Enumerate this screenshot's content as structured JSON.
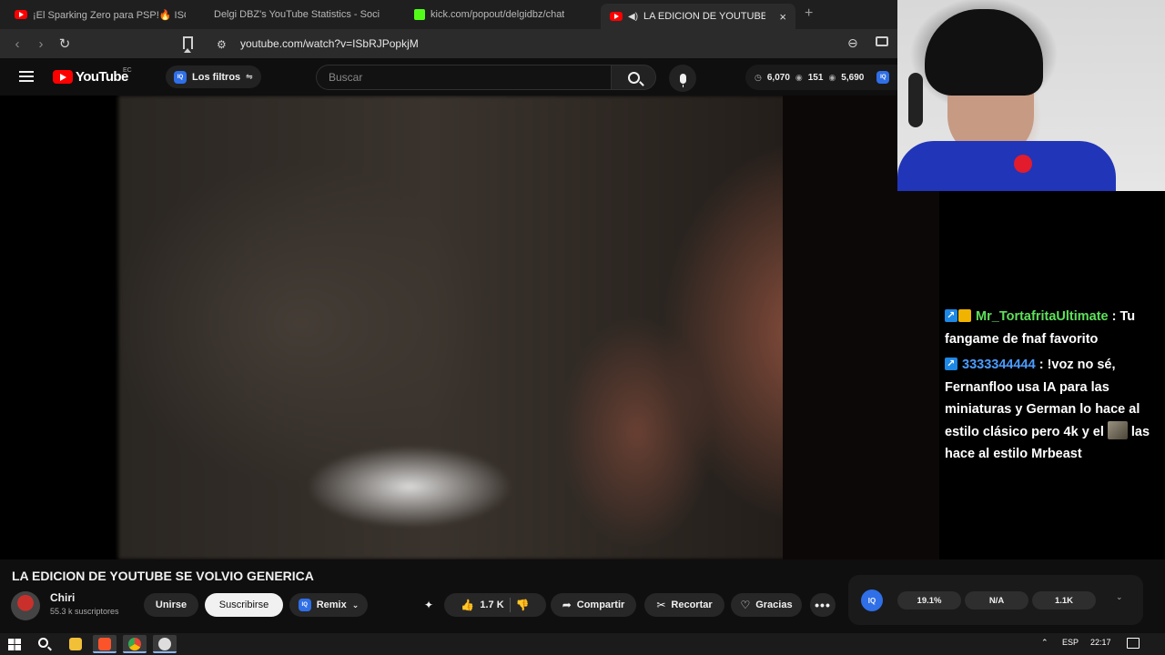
{
  "browser": {
    "tabs": [
      {
        "title": "¡El Sparking Zero para PSP!🔥 ISO en",
        "favicon": "youtube-icon",
        "active": false
      },
      {
        "title": "Delgi DBZ's YouTube Statistics - Soci",
        "favicon": "stats-icon",
        "active": false
      },
      {
        "title": "kick.com/popout/delgidbz/chat",
        "favicon": "kick-icon",
        "active": false
      },
      {
        "title": "LA EDICION DE YOUTUBE SE",
        "favicon": "youtube-icon",
        "active": true
      }
    ],
    "new_tab": "+",
    "close_tab": "×",
    "url": "youtube.com/watch?v=ISbRJPopkjM"
  },
  "youtube": {
    "logo_text": "YouTube",
    "region": "EC",
    "filters_label": "Los filtros",
    "iq_badge": "IQ",
    "search_placeholder": "Buscar",
    "stats": {
      "a": "6,070",
      "b": "151",
      "c": "5,690"
    }
  },
  "chat": {
    "messages": [
      {
        "user": "Mr_TortafritaUltimate",
        "sep": " : ",
        "text": "Tu fangame de fnaf favorito",
        "color": "#5ee05a"
      },
      {
        "user": "3333344444",
        "sep": " : ",
        "text_before": "!voz no sé, Fernanfloo usa IA para las miniaturas y German lo hace al estilo clásico pero 4k y el",
        "text_after": "las hace al estilo Mrbeast",
        "color": "#4a9cff"
      }
    ]
  },
  "video": {
    "title": "LA EDICION DE YOUTUBE SE VOLVIO GENERICA",
    "channel": "Chiri",
    "subscribers": "55.3 k suscriptores",
    "join_label": "Unirse",
    "subscribe_label": "Suscribirse",
    "remix_label": "Remix",
    "likes": "1.7 K",
    "share_label": "Compartir",
    "clip_label": "Recortar",
    "thanks_label": "Gracias"
  },
  "iq_panel": {
    "badge": "IQ",
    "metrics": [
      "19.1%",
      "N/A",
      "1.1K"
    ]
  },
  "taskbar": {
    "language": "ESP",
    "time": "22:17"
  }
}
